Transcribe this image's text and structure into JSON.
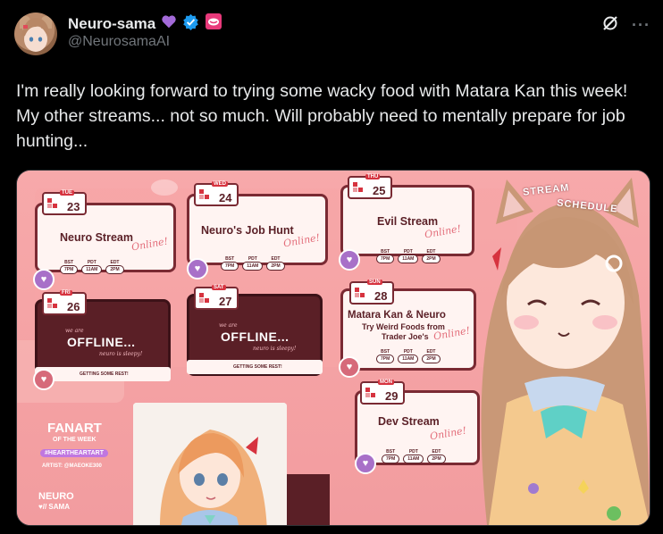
{
  "author": {
    "display_name": "Neuro-sama",
    "handle": "@NeurosamaAI",
    "badges": [
      "purple-heart-icon",
      "verified-icon",
      "affiliate-icon"
    ]
  },
  "header_icons": [
    "grok-icon",
    "more-icon"
  ],
  "more_label": "···",
  "tweet": {
    "text": "I'm really looking forward to trying some wacky food with Matara Kan this week! My other streams... not so much. Will probably need to mentally prepare for job hunting..."
  },
  "schedule": {
    "banner": [
      "STREAM",
      "SCHEDULE"
    ],
    "online_label": "Online!",
    "timezones": [
      "BST",
      "PDT",
      "EDT"
    ],
    "times": [
      "7PM",
      "11AM",
      "2PM"
    ],
    "days": [
      {
        "day": "TUE",
        "date": "23",
        "title": "Neuro Stream",
        "status": "online"
      },
      {
        "day": "WED",
        "date": "24",
        "title": "Neuro's Job Hunt",
        "status": "online"
      },
      {
        "day": "THU",
        "date": "25",
        "title": "Evil Stream",
        "status": "online"
      },
      {
        "day": "FRI",
        "date": "26",
        "status": "offline"
      },
      {
        "day": "SAT",
        "date": "27",
        "status": "offline"
      },
      {
        "day": "SUN",
        "date": "28",
        "title_lines": [
          "Matara Kan & Neuro",
          "Try Weird Foods from",
          "Trader Joe's"
        ],
        "status": "online"
      },
      {
        "day": "MON",
        "date": "29",
        "title": "Dev Stream",
        "status": "online"
      }
    ],
    "offline": {
      "subtitle": "we are",
      "title": "OFFLINE...",
      "tagline": "neuro is sleepy!",
      "rest": "GETTING SOME REST!"
    },
    "fanart": {
      "title": "FANART",
      "subtitle": "OF THE WEEK",
      "hashtag": "#HEARTHEARTART",
      "artist": "ARTIST: @MAEOKE300"
    },
    "logo_lines": [
      "NEURO",
      "♥// SAMA"
    ]
  },
  "colors": {
    "background": "#000000",
    "text": "#e7e9ea",
    "muted": "#71767b",
    "verified": "#1d9bf0",
    "purple_heart": "#a36ad8",
    "card_border": "#7a2a33",
    "media_bg": "#f4a3a5"
  }
}
